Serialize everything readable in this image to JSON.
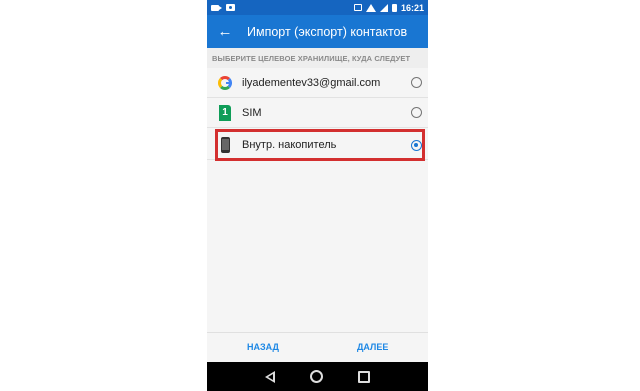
{
  "status_bar": {
    "time": "16:21",
    "icons": [
      "video-icon",
      "camera-icon",
      "cast-icon",
      "wifi-icon",
      "signal-icon",
      "battery-icon"
    ]
  },
  "app_bar": {
    "title": "Импорт (экспорт) контактов",
    "back_icon": "back-arrow-icon",
    "color": "#1976d2"
  },
  "subheader": {
    "text": "ВЫБЕРИТЕ ЦЕЛЕВОЕ ХРАНИЛИЩЕ, КУДА СЛЕДУЕТ"
  },
  "list": {
    "items": [
      {
        "label": "ilyadementev33@gmail.com",
        "icon": "google-icon",
        "selected": false
      },
      {
        "label": "SIM",
        "icon": "sim-icon",
        "icon_text": "1",
        "selected": false
      },
      {
        "label": "Внутр. накопитель",
        "icon": "phone-storage-icon",
        "selected": true
      }
    ]
  },
  "highlight": {
    "color": "#d32f2f"
  },
  "footer": {
    "back_label": "НАЗАД",
    "next_label": "ДАЛЕЕ",
    "accent": "#1e88e5"
  },
  "nav_bar": {
    "icons": [
      "nav-back-icon",
      "nav-home-icon",
      "nav-recents-icon"
    ]
  }
}
